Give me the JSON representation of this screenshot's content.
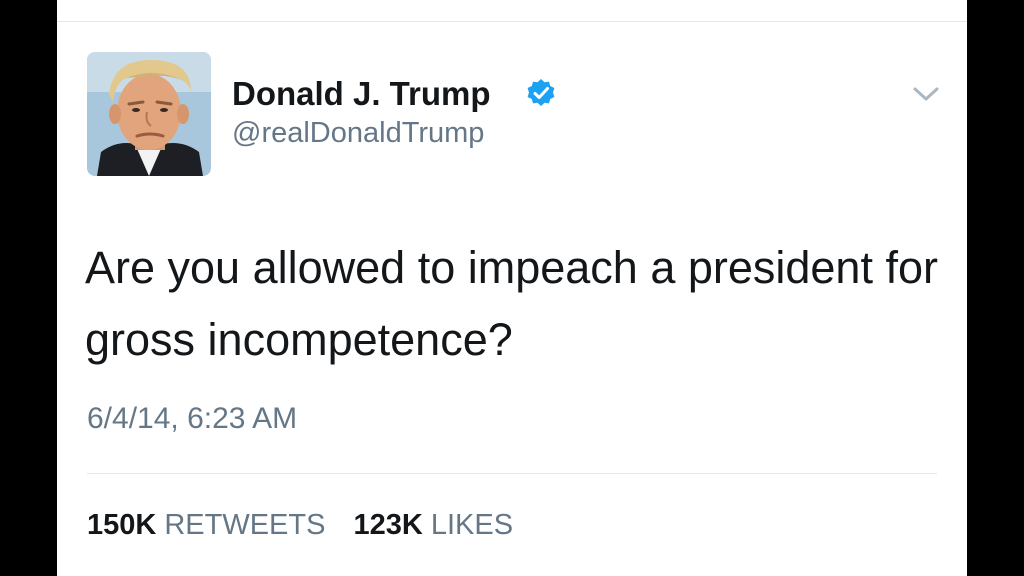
{
  "user": {
    "display_name": "Donald J. Trump",
    "handle": "@realDonaldTrump",
    "verified": true,
    "avatar_icon": "profile-photo",
    "verified_icon": "verified-badge-icon"
  },
  "tweet": {
    "text": "Are you allowed to impeach a president for gross incompetence?",
    "timestamp": "6/4/14, 6:23 AM"
  },
  "stats": {
    "retweets_count": "150K",
    "retweets_label": "RETWEETS",
    "likes_count": "123K",
    "likes_label": "LIKES"
  },
  "menu": {
    "icon": "chevron-down-icon"
  },
  "colors": {
    "verified_blue": "#1da1f2",
    "text_primary": "#14171a",
    "text_secondary": "#657786",
    "divider": "#e1e8ed"
  }
}
